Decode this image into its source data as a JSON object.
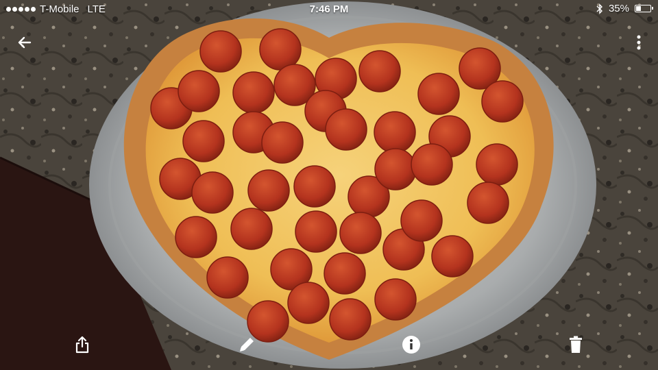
{
  "status_bar": {
    "carrier": "T-Mobile",
    "network": "LTE",
    "time": "7:46 PM",
    "battery": "35%",
    "battery_level": 0.35,
    "icons": [
      "signal-dots-icon",
      "bluetooth-icon",
      "battery-icon"
    ]
  },
  "toolbar": {
    "icons": [
      "back-arrow-icon",
      "more-vertical-icon"
    ]
  },
  "photo": {
    "subject": "heart-shaped pepperoni pizza on metal tray"
  },
  "bottom_actions": {
    "icons": [
      "share-icon",
      "edit-pencil-icon",
      "info-icon",
      "trash-icon"
    ]
  },
  "colors": {
    "countertop": "#3f3a33",
    "tray": "#b9bcbd",
    "crust": "#c6813f",
    "cheese": "#f0c35a",
    "pepperoni": "#b4331e",
    "icon": "#ffffff"
  }
}
